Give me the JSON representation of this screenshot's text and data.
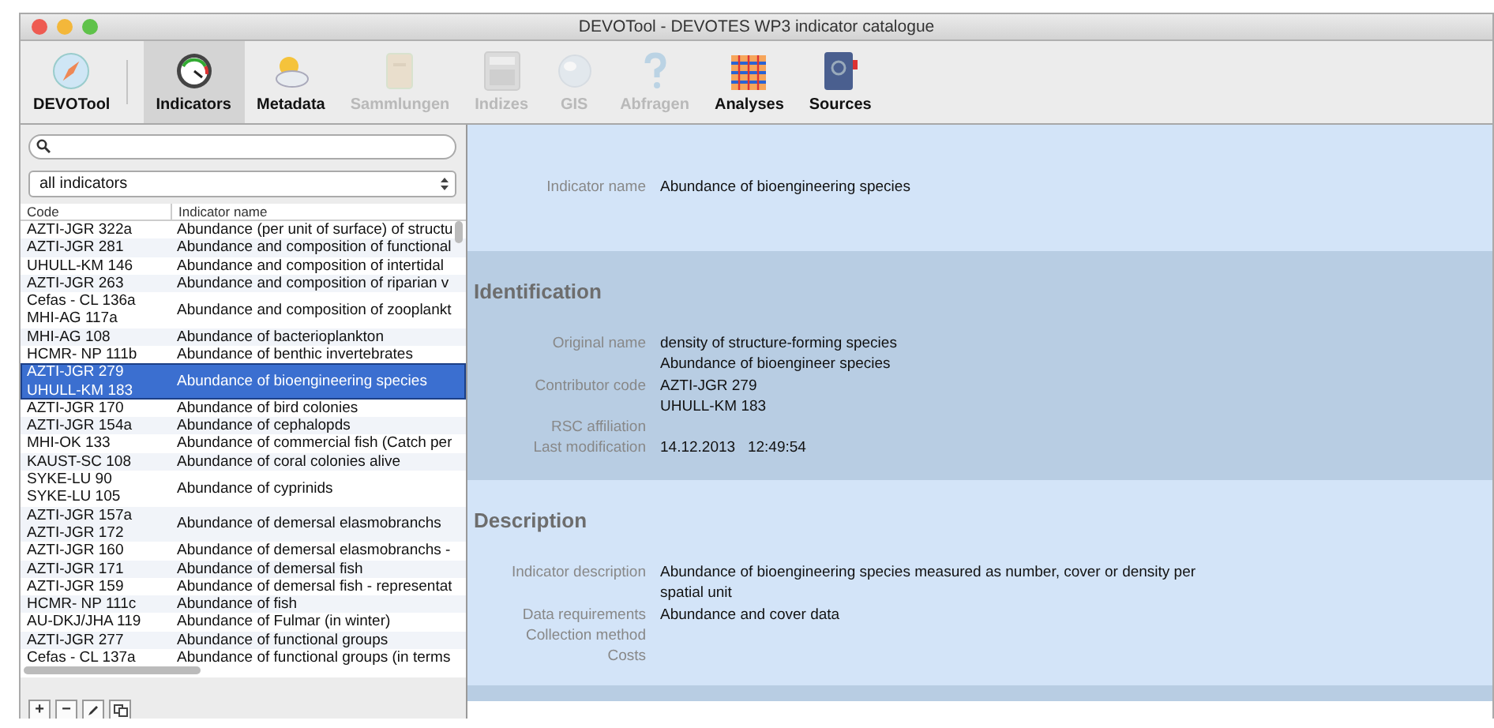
{
  "window": {
    "title": "DEVOTool - DEVOTES WP3 indicator catalogue"
  },
  "toolbar": [
    {
      "label": "DEVOTool",
      "kind": "compass",
      "selected": false,
      "disabled": false
    },
    {
      "label": "Indicators",
      "kind": "gauge",
      "selected": true,
      "disabled": false
    },
    {
      "label": "Metadata",
      "kind": "weather",
      "selected": false,
      "disabled": false
    },
    {
      "label": "Sammlungen",
      "kind": "cabinet",
      "selected": false,
      "disabled": true
    },
    {
      "label": "Indizes",
      "kind": "calculator",
      "selected": false,
      "disabled": true
    },
    {
      "label": "GIS",
      "kind": "globe",
      "selected": false,
      "disabled": true
    },
    {
      "label": "Abfragen",
      "kind": "question",
      "selected": false,
      "disabled": true
    },
    {
      "label": "Analyses",
      "kind": "grid",
      "selected": false,
      "disabled": false
    },
    {
      "label": "Sources",
      "kind": "book",
      "selected": false,
      "disabled": false
    }
  ],
  "filter": {
    "value": "all indicators"
  },
  "table": {
    "columns": [
      "Code",
      "Indicator name"
    ],
    "rows": [
      {
        "codes": [
          "AZTI-JGR 322a"
        ],
        "name": "Abundance (per unit of surface) of structu",
        "selected": false
      },
      {
        "codes": [
          "AZTI-JGR 281"
        ],
        "name": "Abundance and composition of functional",
        "selected": false
      },
      {
        "codes": [
          "UHULL-KM 146"
        ],
        "name": "Abundance and composition of intertidal",
        "selected": false
      },
      {
        "codes": [
          "AZTI-JGR 263"
        ],
        "name": "Abundance and composition of riparian v",
        "selected": false
      },
      {
        "codes": [
          "Cefas - CL 136a",
          "MHI-AG 117a"
        ],
        "name": "Abundance and composition of zooplankt",
        "selected": false
      },
      {
        "codes": [
          "MHI-AG 108"
        ],
        "name": "Abundance of bacterioplankton",
        "selected": false
      },
      {
        "codes": [
          "HCMR- NP 111b"
        ],
        "name": "Abundance of benthic invertebrates",
        "selected": false
      },
      {
        "codes": [
          "AZTI-JGR 279",
          "UHULL-KM 183"
        ],
        "name": "Abundance of bioengineering species",
        "selected": true
      },
      {
        "codes": [
          "AZTI-JGR 170"
        ],
        "name": "Abundance of bird colonies",
        "selected": false
      },
      {
        "codes": [
          "AZTI-JGR 154a"
        ],
        "name": "Abundance of cephalopds",
        "selected": false
      },
      {
        "codes": [
          "MHI-OK 133"
        ],
        "name": "Abundance of commercial fish (Catch per",
        "selected": false
      },
      {
        "codes": [
          "KAUST-SC 108"
        ],
        "name": "Abundance of coral colonies alive",
        "selected": false
      },
      {
        "codes": [
          "SYKE-LU 90",
          "SYKE-LU 105"
        ],
        "name": "Abundance of cyprinids",
        "selected": false
      },
      {
        "codes": [
          "AZTI-JGR 157a",
          "AZTI-JGR 172"
        ],
        "name": "Abundance of demersal elasmobranchs",
        "selected": false
      },
      {
        "codes": [
          "AZTI-JGR 160"
        ],
        "name": "Abundance of demersal elasmobranchs -",
        "selected": false
      },
      {
        "codes": [
          "AZTI-JGR 171"
        ],
        "name": "Abundance of demersal fish",
        "selected": false
      },
      {
        "codes": [
          "AZTI-JGR 159"
        ],
        "name": "Abundance of demersal fish - representat",
        "selected": false
      },
      {
        "codes": [
          "HCMR- NP 111c"
        ],
        "name": "Abundance of fish",
        "selected": false
      },
      {
        "codes": [
          "AU-DKJ/JHA 119"
        ],
        "name": "Abundance of Fulmar (in winter)",
        "selected": false
      },
      {
        "codes": [
          "AZTI-JGR 277"
        ],
        "name": "Abundance of functional groups",
        "selected": false
      },
      {
        "codes": [
          "Cefas - CL 137a"
        ],
        "name": "Abundance of functional groups (in terms",
        "selected": false
      }
    ]
  },
  "list_buttons": [
    {
      "label": "+",
      "kind": "text"
    },
    {
      "label": "−",
      "kind": "text"
    },
    {
      "kind": "pencil"
    },
    {
      "kind": "copy"
    }
  ],
  "detail": {
    "sections": [
      {
        "kind": "plain",
        "fields": [
          {
            "label": "Indicator name",
            "values": [
              "Abundance of bioengineering species"
            ]
          }
        ]
      },
      {
        "kind": "dark",
        "title": "Identification",
        "fields": [
          {
            "label": "Original name",
            "values": [
              "density of structure-forming species",
              "Abundance of bioengineer species"
            ]
          },
          {
            "label": "Contributor code",
            "values": [
              "AZTI-JGR 279",
              "UHULL-KM 183"
            ]
          },
          {
            "label": "RSC affiliation"
          },
          {
            "label": "Last modification",
            "values": [
              "14.12.2013   12:49:54"
            ]
          }
        ]
      },
      {
        "kind": "plain",
        "title": "Description",
        "fields": [
          {
            "label": "Indicator description",
            "values": [
              "Abundance of bioengineering species measured as number, cover or density per spatial unit"
            ]
          },
          {
            "label": "Data requirements",
            "values": [
              "Abundance and cover data"
            ]
          },
          {
            "label": "Collection method"
          },
          {
            "label": "Costs"
          }
        ]
      }
    ]
  }
}
